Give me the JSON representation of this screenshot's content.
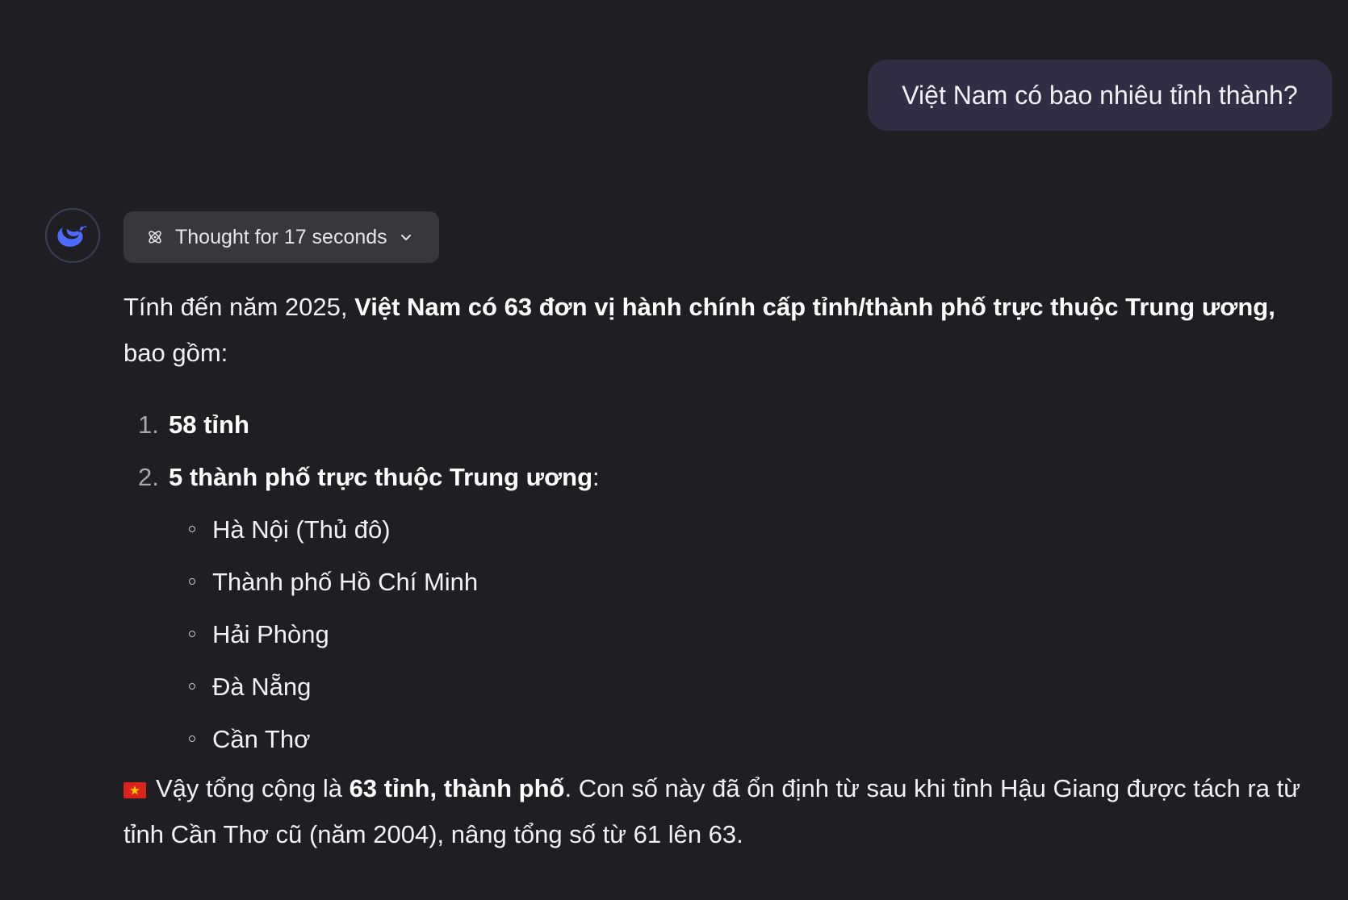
{
  "user_message": {
    "text": "Việt Nam có bao nhiêu tỉnh thành?"
  },
  "assistant": {
    "avatar_icon": "deepseek-whale-icon",
    "thought_button": {
      "label": "Thought for 17 seconds",
      "icon": "atom-icon",
      "chevron": "chevron-down-icon"
    },
    "intro": {
      "prefix": "Tính đến năm 2025, ",
      "bold": "Việt Nam có 63 đơn vị hành chính cấp tỉnh/thành phố trực thuộc Trung ương,",
      "suffix": " bao gồm:"
    },
    "list": [
      {
        "number": "1.",
        "label": "58 tỉnh",
        "suffix": ""
      },
      {
        "number": "2.",
        "label": "5 thành phố trực thuộc Trung ương",
        "suffix": ":"
      }
    ],
    "cities": [
      "Hà Nội (Thủ đô)",
      "Thành phố Hồ Chí Minh",
      "Hải Phòng",
      "Đà Nẵng",
      "Cần Thơ"
    ],
    "summary": {
      "flag_icon": "vietnam-flag-icon",
      "prefix": "Vậy tổng cộng là ",
      "bold": "63 tỉnh, thành phố",
      "suffix": ". Con số này đã ổn định từ sau khi tỉnh Hậu Giang được tách ra từ tỉnh Cần Thơ cũ (năm 2004), nâng tổng số từ 61 lên 63."
    }
  },
  "colors": {
    "background": "#1f1f23",
    "user_bubble": "#2f2e45",
    "thought_button": "#38383c",
    "avatar_accent": "#4d6bfe",
    "text": "#f2f2f4"
  }
}
